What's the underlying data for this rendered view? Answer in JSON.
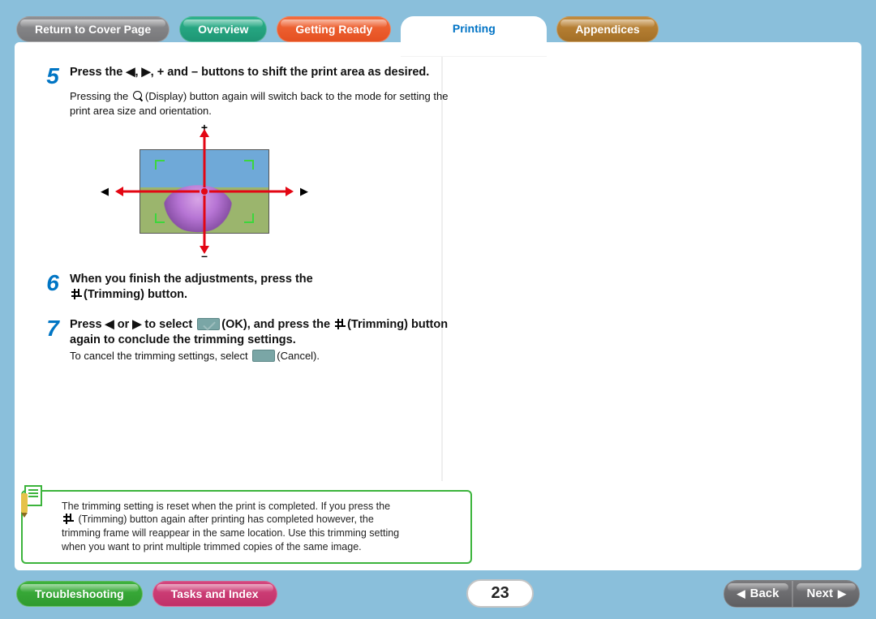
{
  "nav": {
    "cover": "Return to Cover Page",
    "overview": "Overview",
    "getting_ready": "Getting Ready",
    "printing": "Printing",
    "appendices": "Appendices",
    "troubleshooting": "Troubleshooting",
    "tasks_index": "Tasks and Index",
    "back": "Back",
    "next": "Next"
  },
  "page_number": "23",
  "steps": {
    "s5": {
      "num": "5",
      "title": "Press the ◀, ▶, + and – buttons to shift the print area as desired.",
      "body_a": "Pressing the ",
      "body_b": "(Display) button again will switch back to the mode for setting the print area size and orientation."
    },
    "s6": {
      "num": "6",
      "title_a": "When you finish the adjustments, press the ",
      "title_b": "(Trimming) button."
    },
    "s7": {
      "num": "7",
      "title_a": "Press ◀ or ▶ to select ",
      "title_b": "(OK), and press the ",
      "title_c": "(Trimming) button again to conclude the trimming settings.",
      "body_a": "To cancel the trimming settings, select ",
      "body_b": "(Cancel)."
    }
  },
  "diagram": {
    "plus": "+",
    "minus": "–",
    "left": "◀",
    "right": "▶"
  },
  "note": {
    "l1": "The trimming setting is reset when the print is completed. If you press the",
    "l2": " (Trimming) button again after printing has completed however, the",
    "l3": "trimming frame will reappear in the same location. Use this trimming setting",
    "l4": "when you want to print multiple trimmed copies of the same image."
  }
}
